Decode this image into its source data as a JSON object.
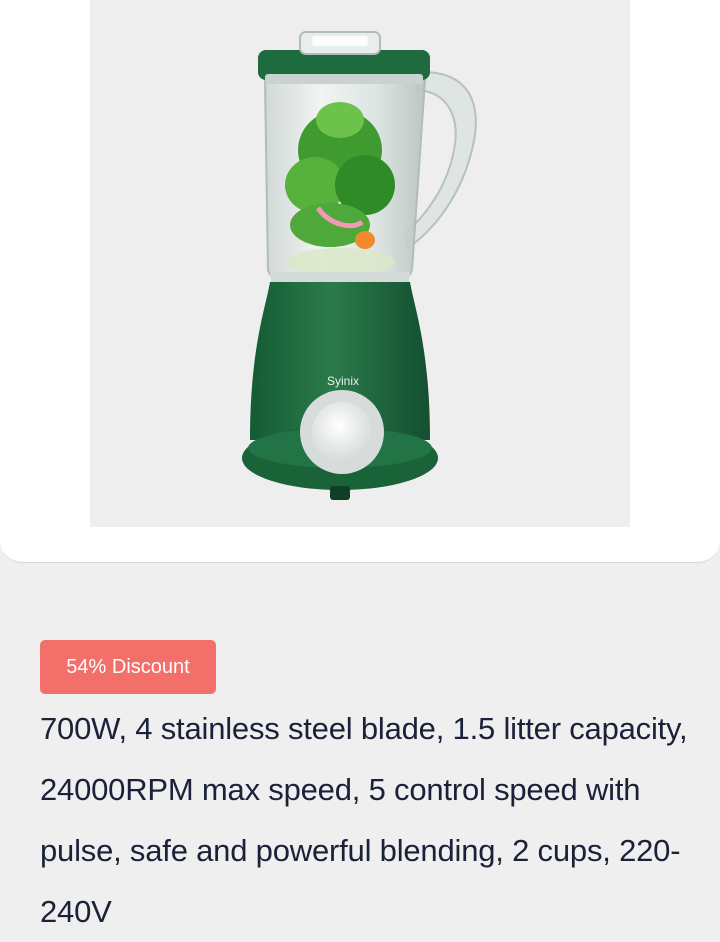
{
  "product": {
    "brand_mark": "Syinix",
    "image_icon": "blender-product-image",
    "colors": {
      "body": "#1f6b40",
      "jar": "#dfe8e4",
      "background": "#eeeeee"
    }
  },
  "offer": {
    "discount_label": "54% Discount",
    "badge_color": "#f26f6a"
  },
  "description": "700W, 4 stainless steel blade, 1.5 litter capacity, 24000RPM max speed, 5 control speed with pulse, safe and powerful blending, 2 cups, 220-240V"
}
